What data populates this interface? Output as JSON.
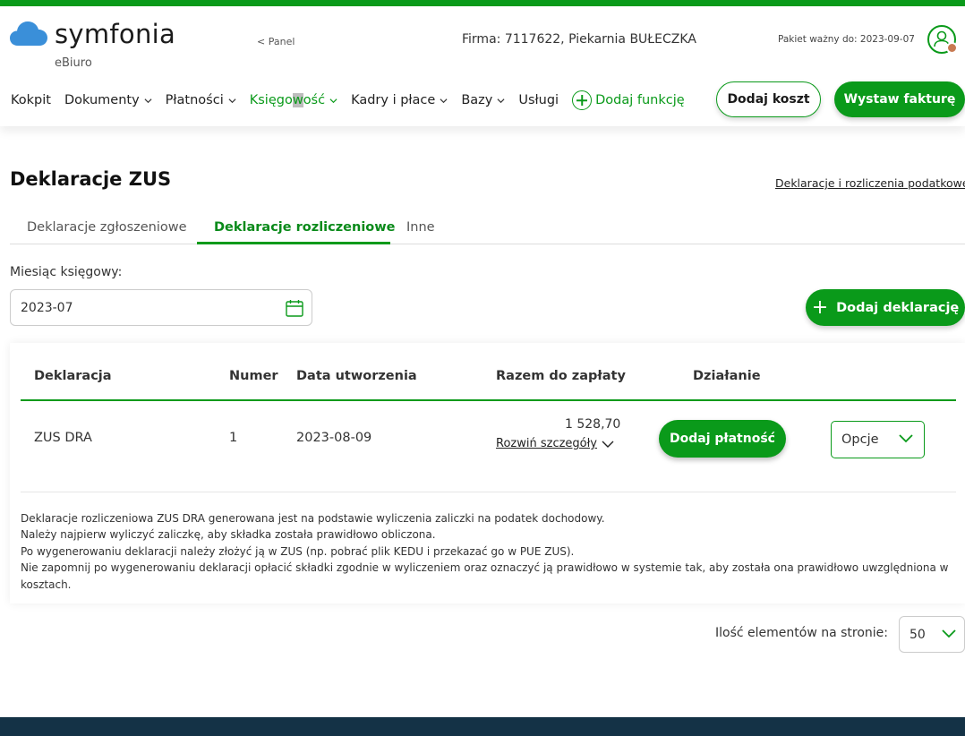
{
  "colors": {
    "brand_green": "#0a9a1a",
    "footer": "#143246",
    "avatar_dot": "#c87a52"
  },
  "header": {
    "logo_text": "symfonia",
    "logo_sub": "eBiuro",
    "panel_link": "< Panel",
    "firma": "Firma:  7117622, Piekarnia BUŁECZKA",
    "pakiet": "Pakiet ważny do: 2023-09-07",
    "user_icon": "user-circle-icon"
  },
  "nav": {
    "items": [
      {
        "label": "Kokpit"
      },
      {
        "label": "Dokumenty"
      },
      {
        "label": "Płatności"
      },
      {
        "label_a": "Księgo",
        "label_b": "w",
        "label_c": "ość"
      },
      {
        "label": "Kadry i płace"
      },
      {
        "label": "Bazy"
      },
      {
        "label": "Usługi"
      }
    ],
    "add_function": "Dodaj funkcję",
    "add_cost": "Dodaj koszt",
    "issue_invoice": "Wystaw fakturę"
  },
  "page": {
    "title": "Deklaracje ZUS",
    "tax_link": "Deklaracje i rozliczenia podatkowe",
    "tabs": [
      {
        "label": "Deklaracje zgłoszeniowe"
      },
      {
        "label": "Deklaracje rozliczeniowe"
      },
      {
        "label": "Inne"
      }
    ],
    "month_label": "Miesiąc księgowy:",
    "month_value": "2023-07",
    "add_declaration": "Dodaj deklarację"
  },
  "table": {
    "headers": [
      "Deklaracja",
      "Numer",
      "Data utworzenia",
      "Razem do zapłaty",
      "Działanie"
    ],
    "rows": [
      {
        "declaration": "ZUS DRA",
        "number": "1",
        "created": "2023-08-09",
        "amount": "1 528,70",
        "expand": "Rozwiń szczegóły",
        "pay_button": "Dodaj płatność",
        "options": "Opcje"
      }
    ],
    "note_lines": [
      "Deklaracje rozliczeniowa ZUS DRA generowana jest na podstawie wyliczenia zaliczki na podatek dochodowy.",
      "Należy najpierw wyliczyć zaliczkę, aby składka została prawidłowo obliczona.",
      "Po wygenerowaniu deklaracji należy złożyć ją w ZUS (np. pobrać plik KEDU i przekazać go w PUE ZUS).",
      "Nie zapomnij po wygenerowaniu deklaracji opłacić składki zgodnie w wyliczeniem oraz oznaczyć ją prawidłowo w systemie tak, aby została ona prawidłowo uwzględniona w kosztach."
    ]
  },
  "pagination": {
    "per_page_label": "Ilość elementów na stronie:",
    "per_page_value": "50"
  }
}
